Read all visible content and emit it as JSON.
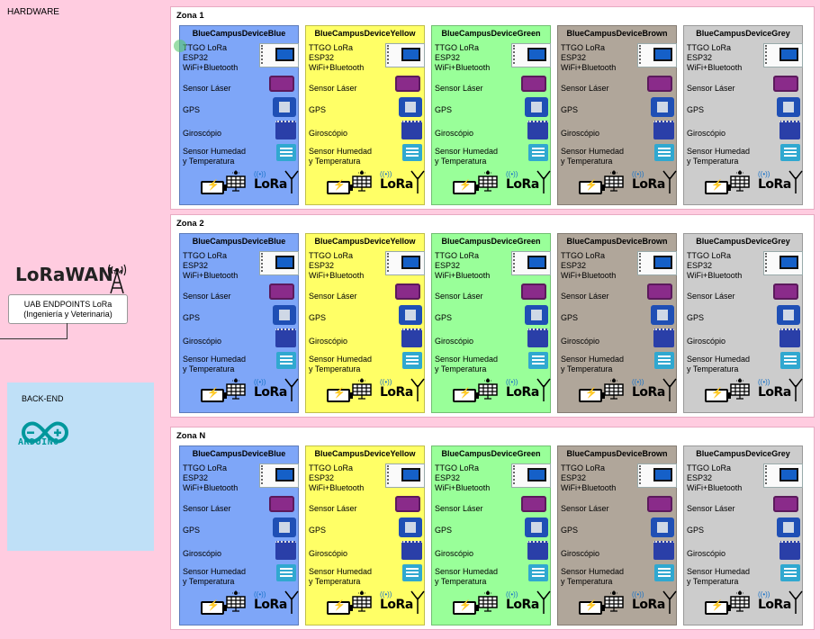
{
  "hardware": {
    "title": "HARDWARE"
  },
  "lorawan": {
    "logo": "LoRaWAN",
    "tm": "TM"
  },
  "endpoints": {
    "line1": "UAB ENDPOINTS LoRa",
    "line2": "(Ingeniería y Veterinaria)"
  },
  "backend": {
    "title": "BACK-END",
    "arduino_label": "ARDUINO"
  },
  "zones": [
    {
      "title": "Zona 1"
    },
    {
      "title": "Zona 2"
    },
    {
      "title": "Zona N"
    }
  ],
  "devices": [
    {
      "name": "BlueCampusDeviceBlue",
      "color": "#7ea6f8"
    },
    {
      "name": "BlueCampusDeviceYellow",
      "color": "#ffff66"
    },
    {
      "name": "BlueCampusDeviceGreen",
      "color": "#99ff99"
    },
    {
      "name": "BlueCampusDeviceBrown",
      "color": "#b0a69a"
    },
    {
      "name": "BlueCampusDeviceGrey",
      "color": "#cccccc"
    }
  ],
  "components": {
    "esp32": "TTGO LoRa\nESP32\nWiFi+Bluetooth",
    "laser": "Sensor Láser",
    "gps": "GPS",
    "gyro": "Giroscópio",
    "humidity": "Sensor Humedad\ny Temperatura",
    "lora": "LoRa"
  },
  "icons": [
    "battery-icon",
    "solar-panel-icon",
    "lora-logo-icon",
    "antenna-icon",
    "antenna-tower-icon",
    "arduino-logo-icon"
  ]
}
